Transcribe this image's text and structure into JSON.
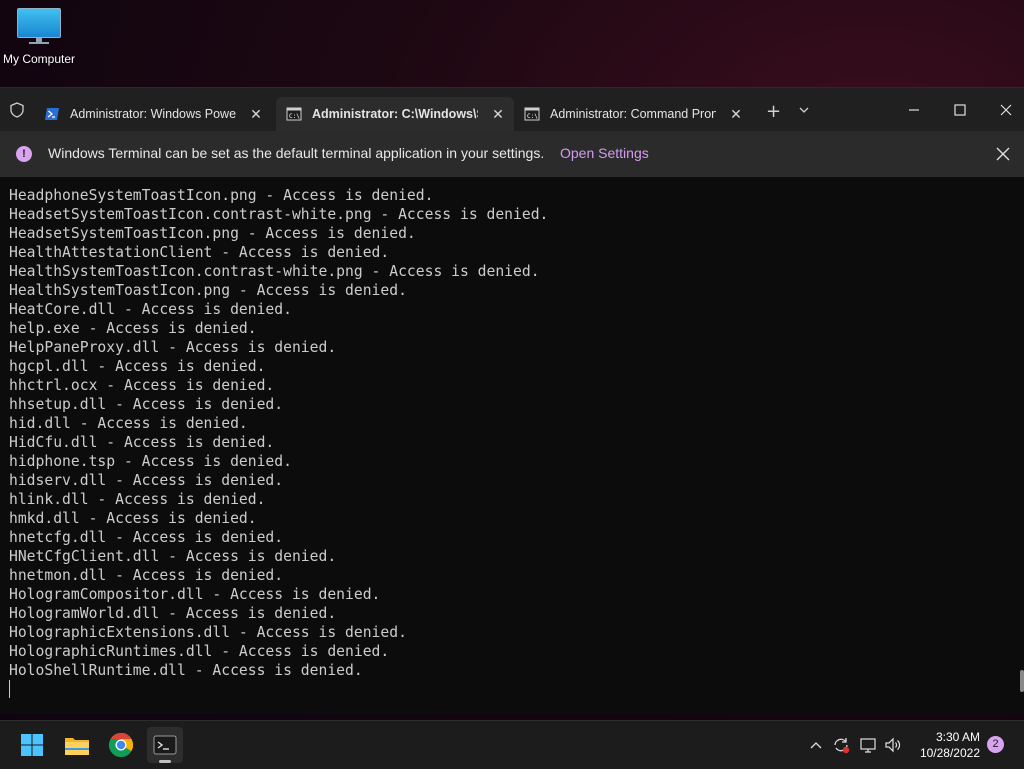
{
  "desktop": {
    "icons": [
      {
        "label": "My Computer",
        "icon": "monitor-icon"
      }
    ]
  },
  "terminal": {
    "tabs": [
      {
        "label": "Administrator: Windows Powe",
        "icon": "powershell-icon",
        "active": false
      },
      {
        "label": "Administrator:  C:\\Windows\\S",
        "icon": "cmd-icon",
        "active": true
      },
      {
        "label": "Administrator: Command Pron",
        "icon": "cmd-icon",
        "active": false
      }
    ],
    "infobar": {
      "message": "Windows Terminal can be set as the default terminal application in your settings.",
      "link": "Open Settings",
      "accent": "#d39cf0"
    },
    "lines": [
      "HeadphoneSystemToastIcon.png - Access is denied.",
      "HeadsetSystemToastIcon.contrast-white.png - Access is denied.",
      "HeadsetSystemToastIcon.png - Access is denied.",
      "HealthAttestationClient - Access is denied.",
      "HealthSystemToastIcon.contrast-white.png - Access is denied.",
      "HealthSystemToastIcon.png - Access is denied.",
      "HeatCore.dll - Access is denied.",
      "help.exe - Access is denied.",
      "HelpPaneProxy.dll - Access is denied.",
      "hgcpl.dll - Access is denied.",
      "hhctrl.ocx - Access is denied.",
      "hhsetup.dll - Access is denied.",
      "hid.dll - Access is denied.",
      "HidCfu.dll - Access is denied.",
      "hidphone.tsp - Access is denied.",
      "hidserv.dll - Access is denied.",
      "hlink.dll - Access is denied.",
      "hmkd.dll - Access is denied.",
      "hnetcfg.dll - Access is denied.",
      "HNetCfgClient.dll - Access is denied.",
      "hnetmon.dll - Access is denied.",
      "HologramCompositor.dll - Access is denied.",
      "HologramWorld.dll - Access is denied.",
      "HolographicExtensions.dll - Access is denied.",
      "HolographicRuntimes.dll - Access is denied.",
      "HoloShellRuntime.dll - Access is denied."
    ]
  },
  "taskbar": {
    "apps": [
      "start-icon",
      "file-explorer-icon",
      "chrome-icon",
      "terminal-icon"
    ],
    "tray": [
      "chevron-up-icon",
      "sync-icon",
      "network-icon",
      "volume-icon"
    ],
    "time": "3:30 AM",
    "date": "10/28/2022",
    "notifications": "2"
  }
}
